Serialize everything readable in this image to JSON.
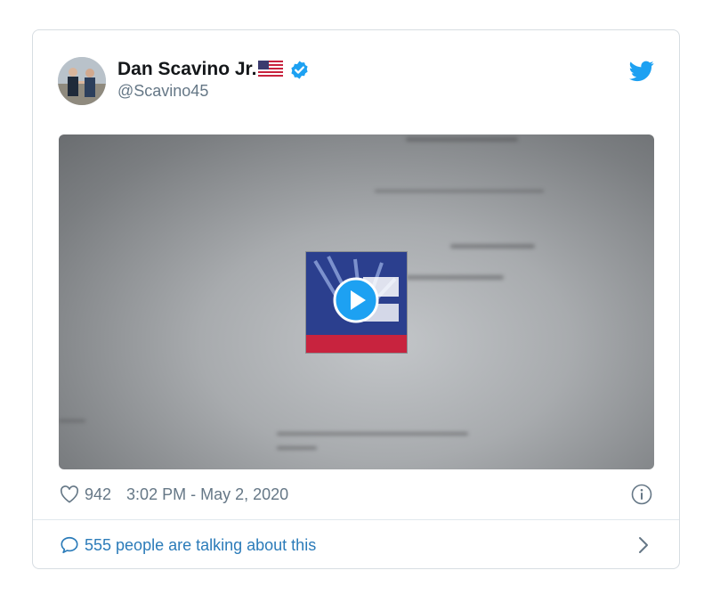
{
  "tweet": {
    "display_name": "Dan Scavino Jr.",
    "handle": "@Scavino45",
    "likes": "942",
    "timestamp": "3:02 PM - May 2, 2020",
    "talking_text": "555 people are talking about this"
  },
  "icons": {
    "verified": "verified-badge-icon",
    "flag": "us-flag-icon",
    "brand": "twitter-bird-icon",
    "like": "heart-icon",
    "info": "info-icon",
    "reply": "speech-bubble-icon",
    "more": "chevron-right-icon",
    "play": "play-icon"
  },
  "colors": {
    "link": "#2b7bb9",
    "verified": "#1da1f2",
    "muted": "#657786",
    "text": "#14171a"
  }
}
